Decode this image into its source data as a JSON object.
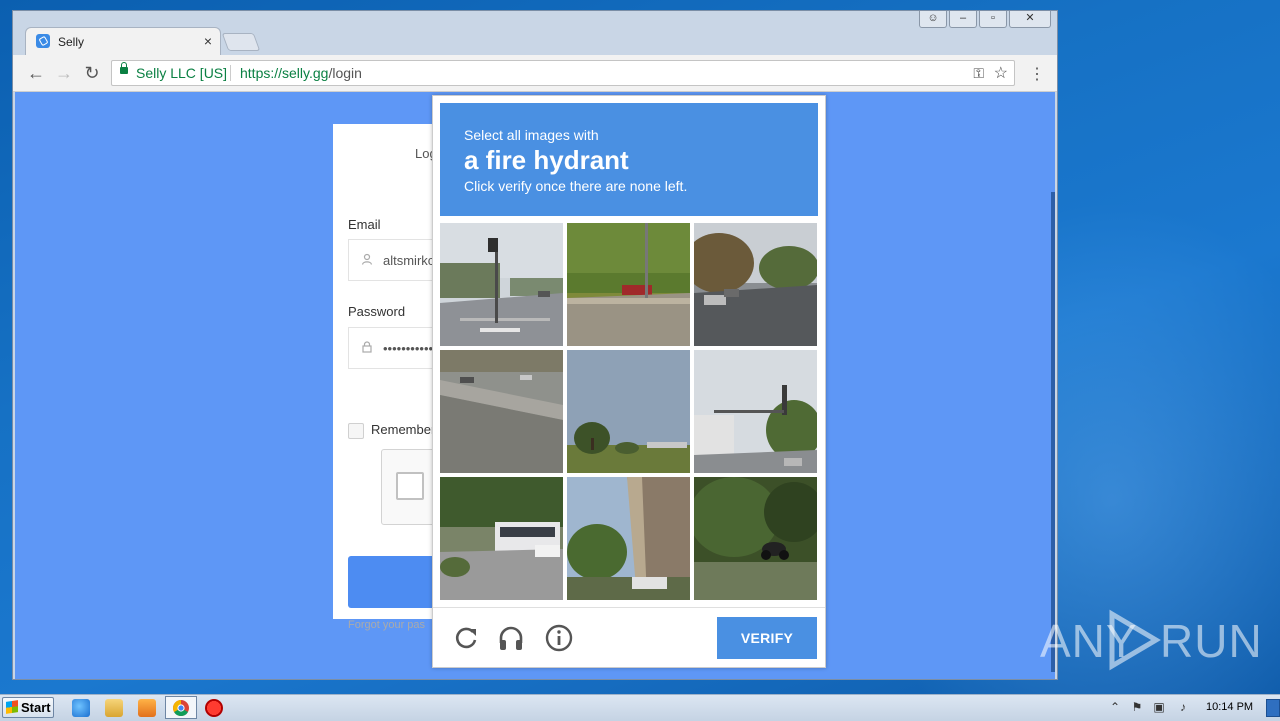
{
  "browser": {
    "tab_title": "Selly",
    "tab_close": "×",
    "omnibox": {
      "org": "Selly LLC [US]",
      "url_scheme_host": "https://selly.gg",
      "url_path": "/login"
    }
  },
  "login_page": {
    "login_tab": "Log",
    "email_label": "Email",
    "email_value": "altsmirkc",
    "password_label": "Password",
    "password_value": "••••••••••••",
    "remember_label": "Remember",
    "forgot_text": "Forgot your pas"
  },
  "captcha": {
    "instruction_line1": "Select all images with",
    "instruction_target": "a fire hydrant",
    "instruction_line3": "Click verify once there are none left.",
    "verify_label": "VERIFY",
    "footer_icons": [
      "reload-icon",
      "audio-icon",
      "info-icon"
    ],
    "tiles": [
      "street-intersection",
      "wall-grass-car",
      "street-autumn-cars",
      "highway-barrier",
      "trees-field",
      "street-traffic-light",
      "bus-parking-lot",
      "overpass-trees",
      "trees-motorcycle"
    ]
  },
  "taskbar": {
    "start_label": "Start",
    "clock": "10:14 PM"
  },
  "watermark": {
    "left": "ANY",
    "right": "RUN"
  },
  "colors": {
    "page_bg": "#5e97f6",
    "captcha_blue": "#4a90e2",
    "secure_green": "#0b8043"
  }
}
